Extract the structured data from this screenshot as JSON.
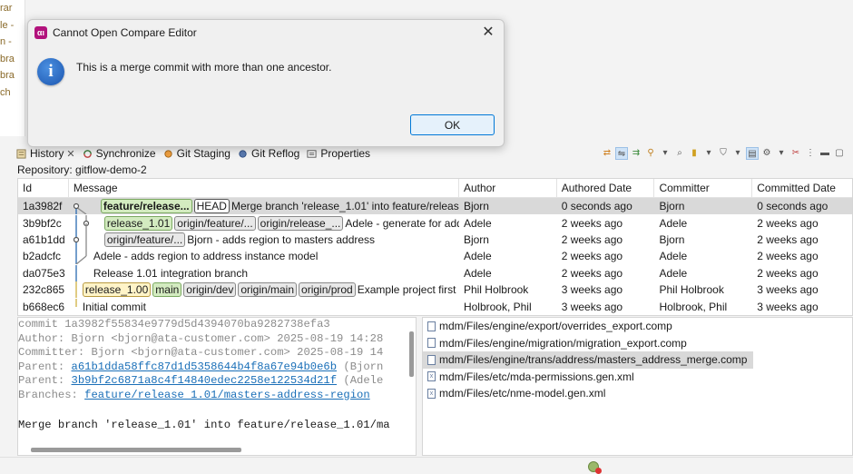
{
  "left_strip": [
    "rar",
    "le -",
    "n -",
    "bra",
    "bra",
    "ch"
  ],
  "dialog": {
    "title": "Cannot Open Compare Editor",
    "app_icon": "αı",
    "message": "This is a merge commit with more than one ancestor.",
    "ok_label": "OK",
    "close_glyph": "✕"
  },
  "views": {
    "tabs": [
      {
        "label": "History",
        "icon": "history-icon",
        "closable": true
      },
      {
        "label": "Synchronize",
        "icon": "synchronize-icon"
      },
      {
        "label": "Git Staging",
        "icon": "git-staging-icon"
      },
      {
        "label": "Git Reflog",
        "icon": "git-reflog-icon"
      },
      {
        "label": "Properties",
        "icon": "properties-icon"
      }
    ]
  },
  "repository_label": "Repository: gitflow-demo-2",
  "table": {
    "headers": [
      "Id",
      "Message",
      "Author",
      "Authored Date",
      "Committer",
      "Committed Date"
    ],
    "rows": [
      {
        "id": "1a3982f",
        "refs": [
          {
            "text": "feature/release...",
            "kind": "branch bold"
          },
          {
            "text": "HEAD",
            "kind": "head"
          }
        ],
        "message": "Merge branch 'release_1.01' into feature/release_1.",
        "author": "Bjorn",
        "authored": "0 seconds ago",
        "committer": "Bjorn",
        "committed": "0 seconds ago"
      },
      {
        "id": "3b9bf2c",
        "refs": [
          {
            "text": "release_1.01",
            "kind": "branch"
          },
          {
            "text": "origin/feature/...",
            "kind": "remote"
          },
          {
            "text": "origin/release_...",
            "kind": "remote"
          }
        ],
        "message": "Adele - generate for addres",
        "author": "Adele",
        "authored": "2 weeks ago",
        "committer": "Adele",
        "committed": "2 weeks ago"
      },
      {
        "id": "a61b1dd",
        "refs": [
          {
            "text": "origin/feature/...",
            "kind": "remote"
          }
        ],
        "message": "Bjorn - adds region to masters address",
        "author": "Bjorn",
        "authored": "2 weeks ago",
        "committer": "Bjorn",
        "committed": "2 weeks ago"
      },
      {
        "id": "b2adcfc",
        "refs": [],
        "message": "Adele - adds region to address instance model",
        "author": "Adele",
        "authored": "2 weeks ago",
        "committer": "Adele",
        "committed": "2 weeks ago"
      },
      {
        "id": "da075e3",
        "refs": [],
        "message": "Release 1.01 integration branch",
        "author": "Adele",
        "authored": "2 weeks ago",
        "committer": "Adele",
        "committed": "2 weeks ago"
      },
      {
        "id": "232c865",
        "refs": [
          {
            "text": "release_1.00",
            "kind": "tag"
          },
          {
            "text": "main",
            "kind": "branch"
          },
          {
            "text": "origin/dev",
            "kind": "remote"
          },
          {
            "text": "origin/main",
            "kind": "remote"
          },
          {
            "text": "origin/prod",
            "kind": "remote"
          }
        ],
        "message": "Example project first",
        "author": "Phil Holbrook",
        "authored": "3 weeks ago",
        "committer": "Phil Holbrook",
        "committed": "3 weeks ago"
      },
      {
        "id": "b668ec6",
        "refs": [],
        "message": "Initial commit",
        "author": "Holbrook, Phil",
        "authored": "3 weeks ago",
        "committer": "Holbrook, Phil",
        "committed": "3 weeks ago"
      }
    ]
  },
  "details": {
    "commit_line": "commit 1a3982f55834e9779d5d4394070ba9282738efa3",
    "author_line": "Author: Bjorn <bjorn@ata-customer.com> 2025-08-19 14:28",
    "committer_line": "Committer: Bjorn <bjorn@ata-customer.com> 2025-08-19 14",
    "parent1_prefix": "Parent: ",
    "parent1_hash": "a61b1dda58ffc87d1d5358644b4f8a67e94b0e6b",
    "parent1_suffix": " (Bjorn",
    "parent2_prefix": "Parent: ",
    "parent2_hash": "3b9bf2c6871a8c4f14840edec2258e122534d21f",
    "parent2_suffix": " (Adele",
    "branches_prefix": "Branches: ",
    "branches_value": "feature/release 1.01/masters-address-region",
    "commit_message": "Merge branch 'release_1.01' into feature/release_1.01/ma"
  },
  "files": [
    {
      "path": "mdm/Files/engine/export/overrides_export.comp",
      "icon": "file-icon"
    },
    {
      "path": "mdm/Files/engine/migration/migration_export.comp",
      "icon": "file-icon"
    },
    {
      "path": "mdm/Files/engine/trans/address/masters_address_merge.comp",
      "icon": "file-icon",
      "selected": true
    },
    {
      "path": "mdm/Files/etc/mda-permissions.gen.xml",
      "icon": "xml-file-icon"
    },
    {
      "path": "mdm/Files/etc/nme-model.gen.xml",
      "icon": "xml-file-icon"
    }
  ],
  "colors": {
    "dialog_bg": "#f0f0f0",
    "ok_border": "#0078d7",
    "selection": "#d9d9d9",
    "link": "#1a6fb8",
    "branch_ref": "#d3ebc0"
  }
}
